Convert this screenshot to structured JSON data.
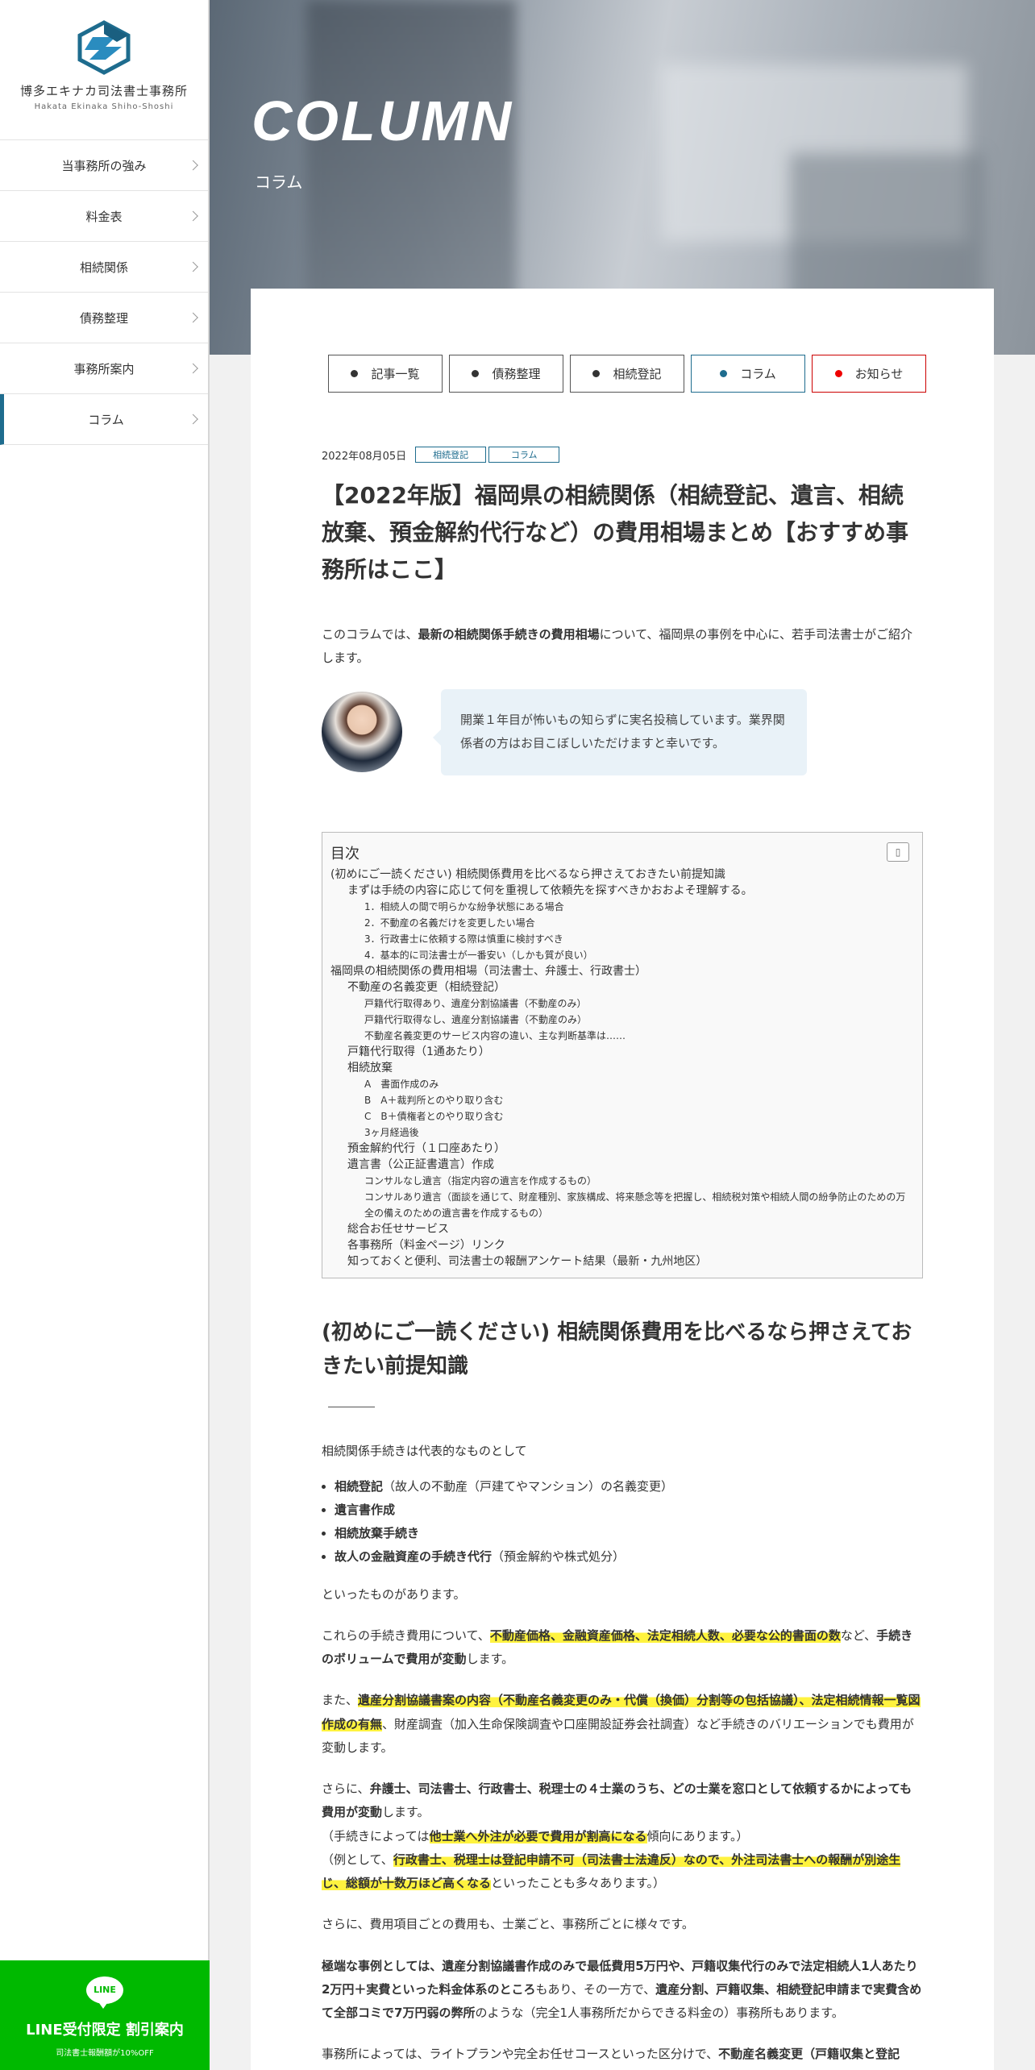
{
  "sidebar": {
    "logo_name": "博多エキナカ司法書士事務所",
    "logo_sub": "Hakata Ekinaka Shiho-Shoshi",
    "items": [
      {
        "label": "当事務所の強み"
      },
      {
        "label": "料金表"
      },
      {
        "label": "相続関係"
      },
      {
        "label": "債務整理"
      },
      {
        "label": "事務所案内"
      },
      {
        "label": "コラム",
        "active": true
      }
    ],
    "line_banner": {
      "badge": "LINE",
      "title": "LINE受付限定 割引案内",
      "note": "司法書士報酬額が10%OFF"
    }
  },
  "hero": {
    "title": "COLUMN",
    "subtitle": "コラム"
  },
  "tabs": [
    {
      "label": "記事一覧"
    },
    {
      "label": "債務整理"
    },
    {
      "label": "相続登記"
    },
    {
      "label": "コラム"
    },
    {
      "label": "お知らせ"
    }
  ],
  "article": {
    "date": "2022年08月05日",
    "tags": [
      "相続登記",
      "コラム"
    ],
    "title": "【2022年版】福岡県の相続関係（相続登記、遺言、相続放棄、預金解約代行など）の費用相場まとめ【おすすめ事務所はここ】",
    "intro": {
      "pre": "このコラムでは、",
      "b1": "最新の",
      "b2": "相続関係手続きの費用相場",
      "post": "について、福岡県の事例を中心に、若手司法書士がご紹介します。"
    },
    "speech": "開業１年目が怖いもの知らずに実名投稿しています。業界関係者の方はお目こぼしいただけますと幸いです。",
    "toc": {
      "title": "目次",
      "toggle": "▯",
      "items": [
        {
          "level": 1,
          "text": "(初めにご一読ください) 相続関係費用を比べるなら押さえておきたい前提知識"
        },
        {
          "level": 2,
          "text": "まずは手続の内容に応じて何を重視して依頼先を探すべきかおおよそ理解する。"
        },
        {
          "level": 3,
          "text": "1．相続人の間で明らかな紛争状態にある場合"
        },
        {
          "level": 3,
          "text": "2．不動産の名義だけを変更したい場合"
        },
        {
          "level": 3,
          "text": "3．行政書士に依頼する際は慎重に検討すべき"
        },
        {
          "level": 3,
          "text": "4．基本的に司法書士が一番安い（しかも質が良い）"
        },
        {
          "level": 1,
          "text": "福岡県の相続関係の費用相場（司法書士、弁護士、行政書士）"
        },
        {
          "level": 2,
          "text": "不動産の名義変更（相続登記）"
        },
        {
          "level": 3,
          "text": "戸籍代行取得あり、遺産分割協議書（不動産のみ）"
        },
        {
          "level": 3,
          "text": "戸籍代行取得なし、遺産分割協議書（不動産のみ）"
        },
        {
          "level": 3,
          "text": "不動産名義変更のサービス内容の違い、主な判断基準は……"
        },
        {
          "level": 2,
          "text": "戸籍代行取得（1通あたり）"
        },
        {
          "level": 2,
          "text": "相続放棄"
        },
        {
          "level": 3,
          "text": "A　書面作成のみ"
        },
        {
          "level": 3,
          "text": "B　A＋裁判所とのやり取り含む"
        },
        {
          "level": 3,
          "text": "C　B＋債権者とのやり取り含む"
        },
        {
          "level": 3,
          "text": "3ヶ月経過後"
        },
        {
          "level": 2,
          "text": "預金解約代行（１口座あたり）"
        },
        {
          "level": 2,
          "text": "遺言書（公正証書遺言）作成"
        },
        {
          "level": 3,
          "text": "コンサルなし遺言（指定内容の遺言を作成するもの）"
        },
        {
          "level": 3,
          "text": "コンサルあり遺言（面談を通じて、財産種別、家族構成、将来懸念等を把握し、相続税対策や相続人間の紛争防止のための万全の備えのための遺言書を作成するもの）"
        },
        {
          "level": 2,
          "text": "総合お任せサービス"
        },
        {
          "level": 2,
          "text": "各事務所（料金ページ）リンク"
        },
        {
          "level": 2,
          "text": "知っておくと便利、司法書士の報酬アンケート結果（最新・九州地区）"
        }
      ]
    },
    "h2": "(初めにご一読ください) 相続関係費用を比べるなら押さえておきたい前提知識",
    "p1": "相続関係手続きは代表的なものとして",
    "list": [
      {
        "b": "相続登記",
        "t": "（故人の不動産（戸建てやマンション）の名義変更）"
      },
      {
        "b": "遺言書作成",
        "t": ""
      },
      {
        "b": "相続放棄手続き",
        "t": ""
      },
      {
        "b": "故人の金融資産の手続き代行",
        "t": "（預金解約や株式処分）"
      }
    ],
    "p2": "といったものがあります。",
    "p3": {
      "a": "これらの手続き費用について、",
      "h": "不動産価格、金融資産価格、法定相続人数、必要な公的書面の数",
      "b": "など、",
      "c": "手続きのボリュームで費用が変動",
      "d": "します。"
    },
    "p4": {
      "a": "また、",
      "h": "遺産分割協議書案の内容（不動産名義変更のみ・代償（換価）分割等の包括協議）、法定相続情報一覧図作成の有無",
      "b": "、財産調査（加入生命保険調査や口座開設証券会社調査）など手続きのバリエーションでも費用が変動します。"
    },
    "p5": {
      "a": "さらに、",
      "b1": "弁護士、司法書士、行政書士、税理士の４士業のうち、どの士業を窓口として依頼するかによっても費用が変動",
      "c": "します。",
      "d": "（手続きによっては",
      "h1": "他士業へ外注が必要で費用が割高になる",
      "e": "傾向にあります。）",
      "f": "（例として、",
      "h2": "行政書士、税理士は登記申請不可（司法書士法違反）なので、外注司法書士への報酬が別途生じ、総額が十数万ほど高くなる",
      "g": "といったことも多々あります。）"
    },
    "p6": "さらに、費用項目ごとの費用も、士業ごと、事務所ごとに様々です。",
    "p7": {
      "b1": "極端な事例としては、遺産分割協議書作成のみで最低費用5万円や、戸籍収集代行のみで法定相続人1人あたり2万円＋実費といった料金体系のところ",
      "a": "もあり、その一方で、",
      "b2": "遺産分割、戸籍収集、相続登記申請まで実費含めて全部コミで7万円弱の弊所",
      "c": "のような（完全1人事務所だからできる料金の）事務所もあります。"
    },
    "p8": {
      "a": "事務所によっては、ライトプランや完全お任せコースといった区分けで、",
      "b": "不動産名義変更（戸籍収集と登記"
    }
  }
}
